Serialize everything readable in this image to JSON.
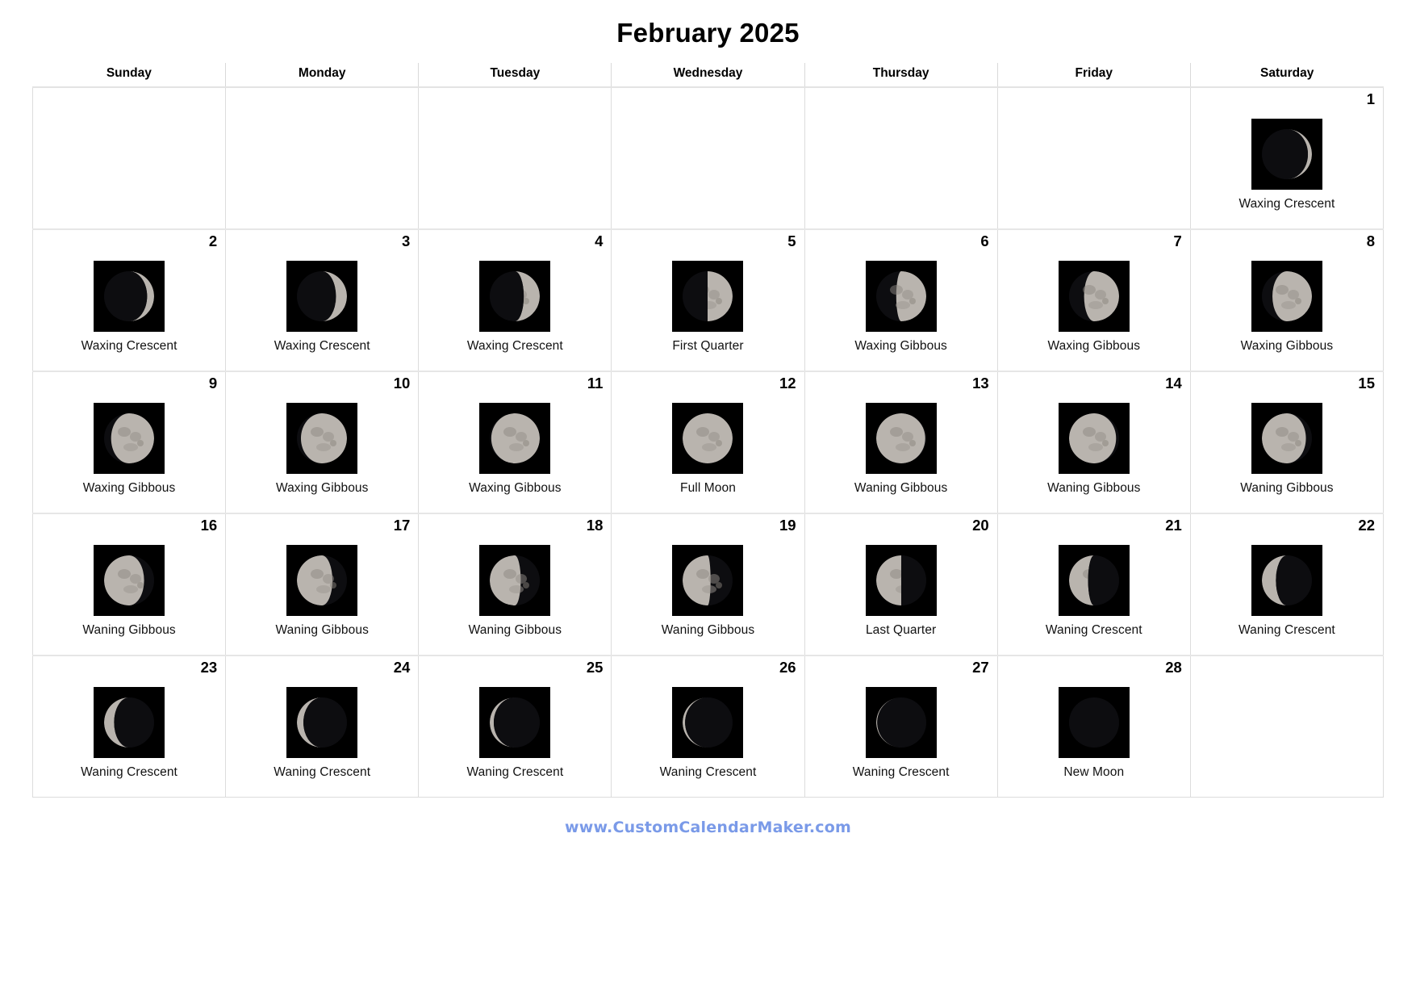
{
  "title": "February 2025",
  "weekdays": [
    "Sunday",
    "Monday",
    "Tuesday",
    "Wednesday",
    "Thursday",
    "Friday",
    "Saturday"
  ],
  "footer": {
    "url": "www.CustomCalendarMaker.com",
    "color": "#7a9ae8"
  },
  "colors": {
    "grid_border": "#dcdcdc",
    "header_rule": "#e6e6e6",
    "moon_bg": "#000000",
    "moon_lit": "#b9b4ae",
    "moon_dark": "#0d0d10",
    "text": "#000000"
  },
  "phase_icons": {
    "waxing_crescent": "moon-waxing-crescent-icon",
    "first_quarter": "moon-first-quarter-icon",
    "waxing_gibbous": "moon-waxing-gibbous-icon",
    "full_moon": "moon-full-icon",
    "waning_gibbous": "moon-waning-gibbous-icon",
    "last_quarter": "moon-last-quarter-icon",
    "waning_crescent": "moon-waning-crescent-icon",
    "new_moon": "moon-new-icon"
  },
  "weeks": [
    [
      {
        "day": "",
        "phase": "",
        "illum": null,
        "waxing": null,
        "empty": true
      },
      {
        "day": "",
        "phase": "",
        "illum": null,
        "waxing": null,
        "empty": true
      },
      {
        "day": "",
        "phase": "",
        "illum": null,
        "waxing": null,
        "empty": true
      },
      {
        "day": "",
        "phase": "",
        "illum": null,
        "waxing": null,
        "empty": true
      },
      {
        "day": "",
        "phase": "",
        "illum": null,
        "waxing": null,
        "empty": true
      },
      {
        "day": "",
        "phase": "",
        "illum": null,
        "waxing": null,
        "empty": true
      },
      {
        "day": "1",
        "phase": "Waxing Crescent",
        "illum": 0.08,
        "waxing": true,
        "empty": false
      }
    ],
    [
      {
        "day": "2",
        "phase": "Waxing Crescent",
        "illum": 0.14,
        "waxing": true,
        "empty": false
      },
      {
        "day": "3",
        "phase": "Waxing Crescent",
        "illum": 0.22,
        "waxing": true,
        "empty": false
      },
      {
        "day": "4",
        "phase": "Waxing Crescent",
        "illum": 0.32,
        "waxing": true,
        "empty": false
      },
      {
        "day": "5",
        "phase": "First Quarter",
        "illum": 0.5,
        "waxing": true,
        "empty": false
      },
      {
        "day": "6",
        "phase": "Waxing Gibbous",
        "illum": 0.6,
        "waxing": true,
        "empty": false
      },
      {
        "day": "7",
        "phase": "Waxing Gibbous",
        "illum": 0.7,
        "waxing": true,
        "empty": false
      },
      {
        "day": "8",
        "phase": "Waxing Gibbous",
        "illum": 0.79,
        "waxing": true,
        "empty": false
      }
    ],
    [
      {
        "day": "9",
        "phase": "Waxing Gibbous",
        "illum": 0.86,
        "waxing": true,
        "empty": false
      },
      {
        "day": "10",
        "phase": "Waxing Gibbous",
        "illum": 0.92,
        "waxing": true,
        "empty": false
      },
      {
        "day": "11",
        "phase": "Waxing Gibbous",
        "illum": 0.97,
        "waxing": true,
        "empty": false
      },
      {
        "day": "12",
        "phase": "Full Moon",
        "illum": 1.0,
        "waxing": true,
        "empty": false
      },
      {
        "day": "13",
        "phase": "Waning Gibbous",
        "illum": 0.98,
        "waxing": false,
        "empty": false
      },
      {
        "day": "14",
        "phase": "Waning Gibbous",
        "illum": 0.94,
        "waxing": false,
        "empty": false
      },
      {
        "day": "15",
        "phase": "Waning Gibbous",
        "illum": 0.88,
        "waxing": false,
        "empty": false
      }
    ],
    [
      {
        "day": "16",
        "phase": "Waning Gibbous",
        "illum": 0.8,
        "waxing": false,
        "empty": false
      },
      {
        "day": "17",
        "phase": "Waning Gibbous",
        "illum": 0.71,
        "waxing": false,
        "empty": false
      },
      {
        "day": "18",
        "phase": "Waning Gibbous",
        "illum": 0.62,
        "waxing": false,
        "empty": false
      },
      {
        "day": "19",
        "phase": "Waning Gibbous",
        "illum": 0.56,
        "waxing": false,
        "empty": false
      },
      {
        "day": "20",
        "phase": "Last Quarter",
        "illum": 0.5,
        "waxing": false,
        "empty": false
      },
      {
        "day": "21",
        "phase": "Waning Crescent",
        "illum": 0.38,
        "waxing": false,
        "empty": false
      },
      {
        "day": "22",
        "phase": "Waning Crescent",
        "illum": 0.28,
        "waxing": false,
        "empty": false
      }
    ],
    [
      {
        "day": "23",
        "phase": "Waning Crescent",
        "illum": 0.2,
        "waxing": false,
        "empty": false
      },
      {
        "day": "24",
        "phase": "Waning Crescent",
        "illum": 0.13,
        "waxing": false,
        "empty": false
      },
      {
        "day": "25",
        "phase": "Waning Crescent",
        "illum": 0.08,
        "waxing": false,
        "empty": false
      },
      {
        "day": "26",
        "phase": "Waning Crescent",
        "illum": 0.05,
        "waxing": false,
        "empty": false
      },
      {
        "day": "27",
        "phase": "Waning Crescent",
        "illum": 0.02,
        "waxing": false,
        "empty": false
      },
      {
        "day": "28",
        "phase": "New Moon",
        "illum": 0.0,
        "waxing": false,
        "empty": false
      },
      {
        "day": "",
        "phase": "",
        "illum": null,
        "waxing": null,
        "empty": true
      }
    ]
  ]
}
